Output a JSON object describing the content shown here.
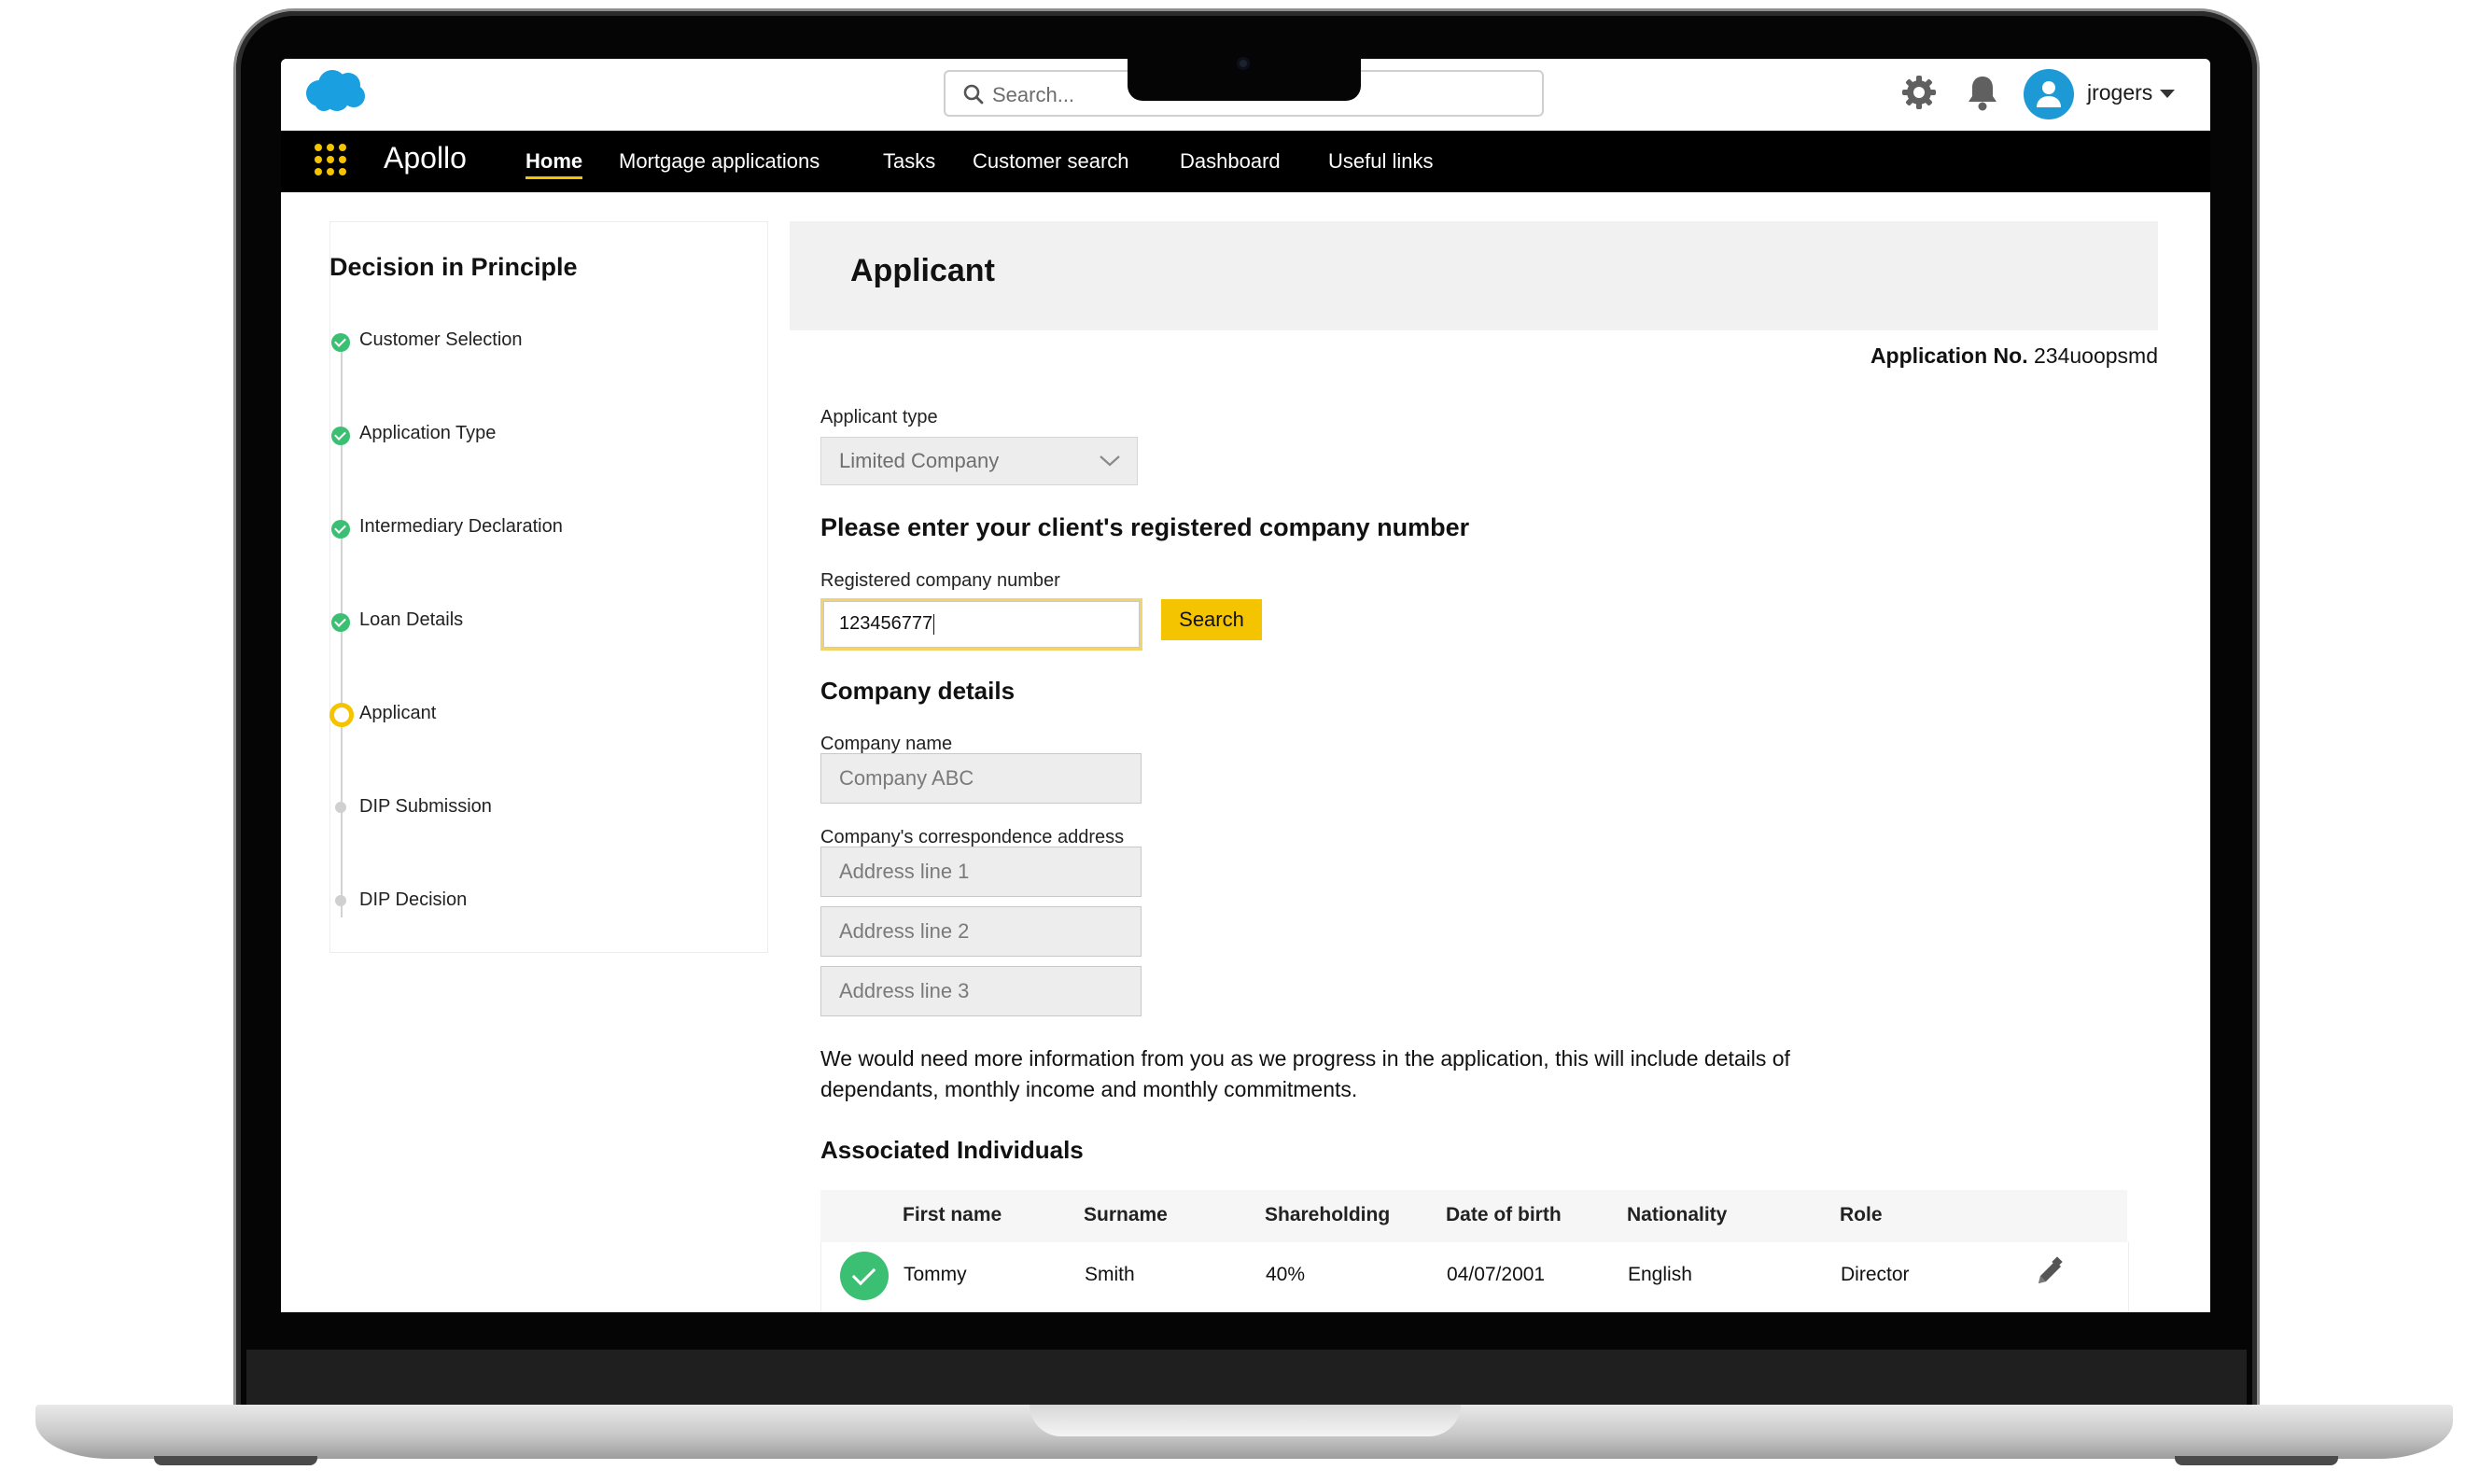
{
  "topbar": {
    "search_placeholder": "Search...",
    "username": "jrogers",
    "icons": [
      "salesforce-cloud-logo",
      "search-icon",
      "gear-icon",
      "bell-icon",
      "user-avatar-icon",
      "caret-down-icon"
    ]
  },
  "nav": {
    "app_name": "Apollo",
    "items": [
      {
        "label": "Home",
        "active": true
      },
      {
        "label": "Mortgage applications",
        "active": false
      },
      {
        "label": "Tasks",
        "active": false
      },
      {
        "label": "Customer search",
        "active": false
      },
      {
        "label": "Dashboard",
        "active": false
      },
      {
        "label": "Useful links",
        "active": false
      }
    ],
    "accent_color": "#f5c400"
  },
  "stepper": {
    "title": "Decision in Principle",
    "steps": [
      {
        "label": "Customer Selection",
        "status": "complete"
      },
      {
        "label": "Application Type",
        "status": "complete"
      },
      {
        "label": "Intermediary Declaration",
        "status": "complete"
      },
      {
        "label": "Loan Details",
        "status": "complete"
      },
      {
        "label": "Applicant",
        "status": "current"
      },
      {
        "label": "DIP Submission",
        "status": "pending"
      },
      {
        "label": "DIP Decision",
        "status": "pending"
      }
    ]
  },
  "main": {
    "title": "Applicant",
    "application_no_label": "Application No.",
    "application_no": "234uoopsmd",
    "applicant_type_label": "Applicant type",
    "applicant_type_value": "Limited Company",
    "company_number_heading": "Please enter your client's registered company number",
    "company_number_label": "Registered company number",
    "company_number_value": "123456777",
    "search_button": "Search",
    "company_details_heading": "Company details",
    "company_name_label": "Company name",
    "company_name_placeholder": "Company ABC",
    "address_label": "Company's correspondence address",
    "address_placeholders": [
      "Address line 1",
      "Address line 2",
      "Address line 3"
    ],
    "info_text": "We would need more information from you as we progress in the application, this will include details of dependants, monthly income and monthly commitments.",
    "associated_heading": "Associated Individuals",
    "table": {
      "columns": [
        "First name",
        "Surname",
        "Shareholding",
        "Date of birth",
        "Nationality",
        "Role"
      ],
      "rows": [
        {
          "verified": true,
          "cells": [
            "Tommy",
            "Smith",
            "40%",
            "04/07/2001",
            "English",
            "Director"
          ]
        }
      ]
    }
  }
}
